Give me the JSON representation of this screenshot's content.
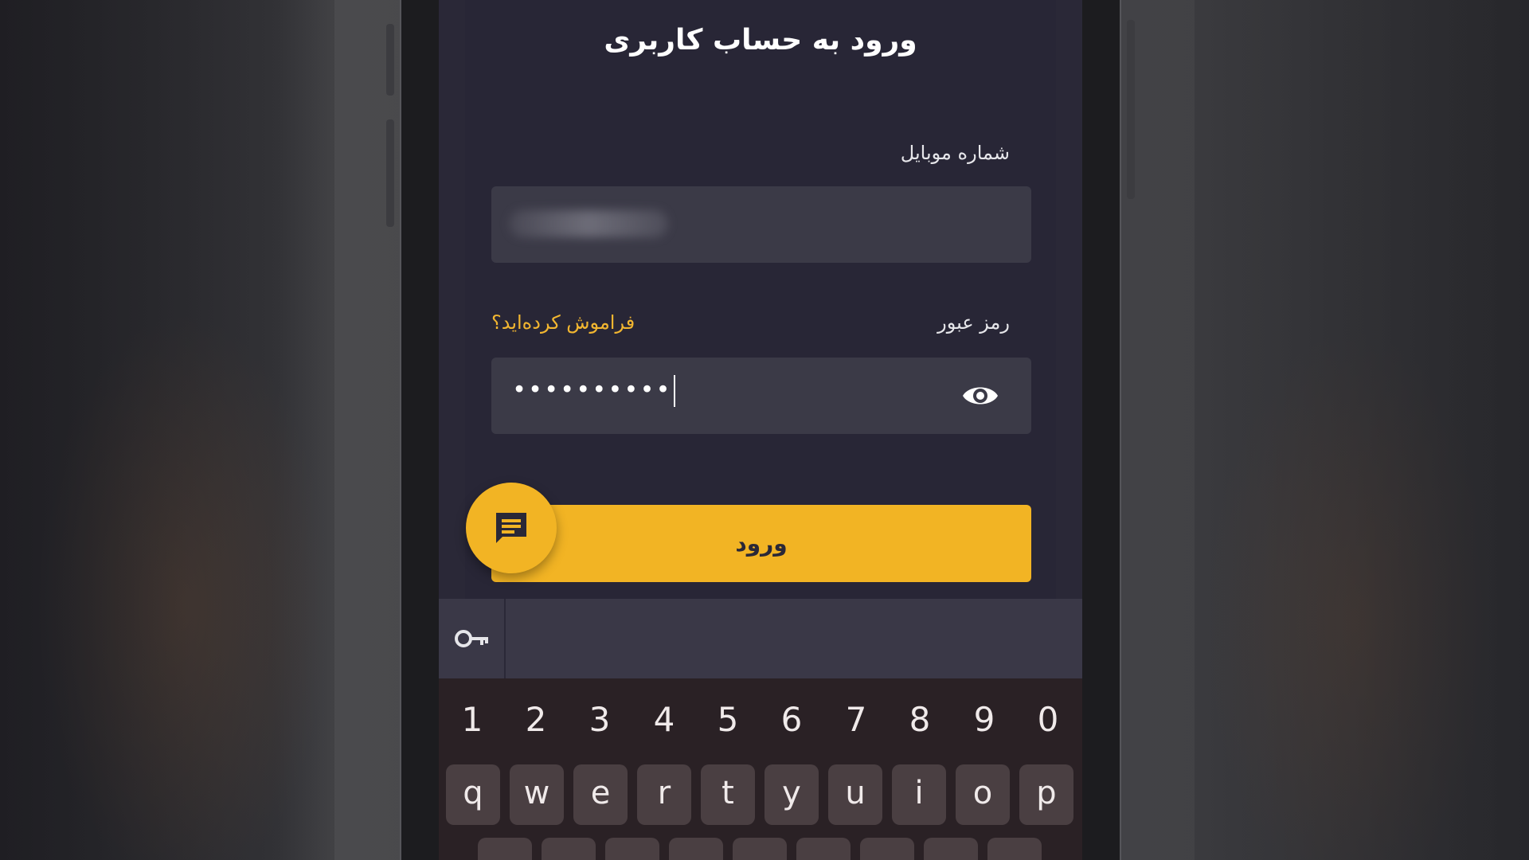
{
  "login": {
    "title": "ورود به حساب کاربری",
    "phone_label": "شماره موبایل",
    "password_label": "رمز عبور",
    "forgot_link": "فراموش کرده‌اید؟",
    "password_masked": "••••••••••",
    "login_button": "ورود"
  },
  "icons": {
    "password_toggle": "eye-icon",
    "chat": "chat-bubble-icon",
    "keyboard_toolbar": "key-icon"
  },
  "keyboard": {
    "number_row": [
      "1",
      "2",
      "3",
      "4",
      "5",
      "6",
      "7",
      "8",
      "9",
      "0"
    ],
    "row_qwerty": [
      "q",
      "w",
      "e",
      "r",
      "t",
      "y",
      "u",
      "i",
      "o",
      "p"
    ]
  },
  "colors": {
    "accent": "#f2b424",
    "screen_bg": "#2a2837",
    "input_bg": "#3b3a47",
    "link": "#f2b630"
  }
}
